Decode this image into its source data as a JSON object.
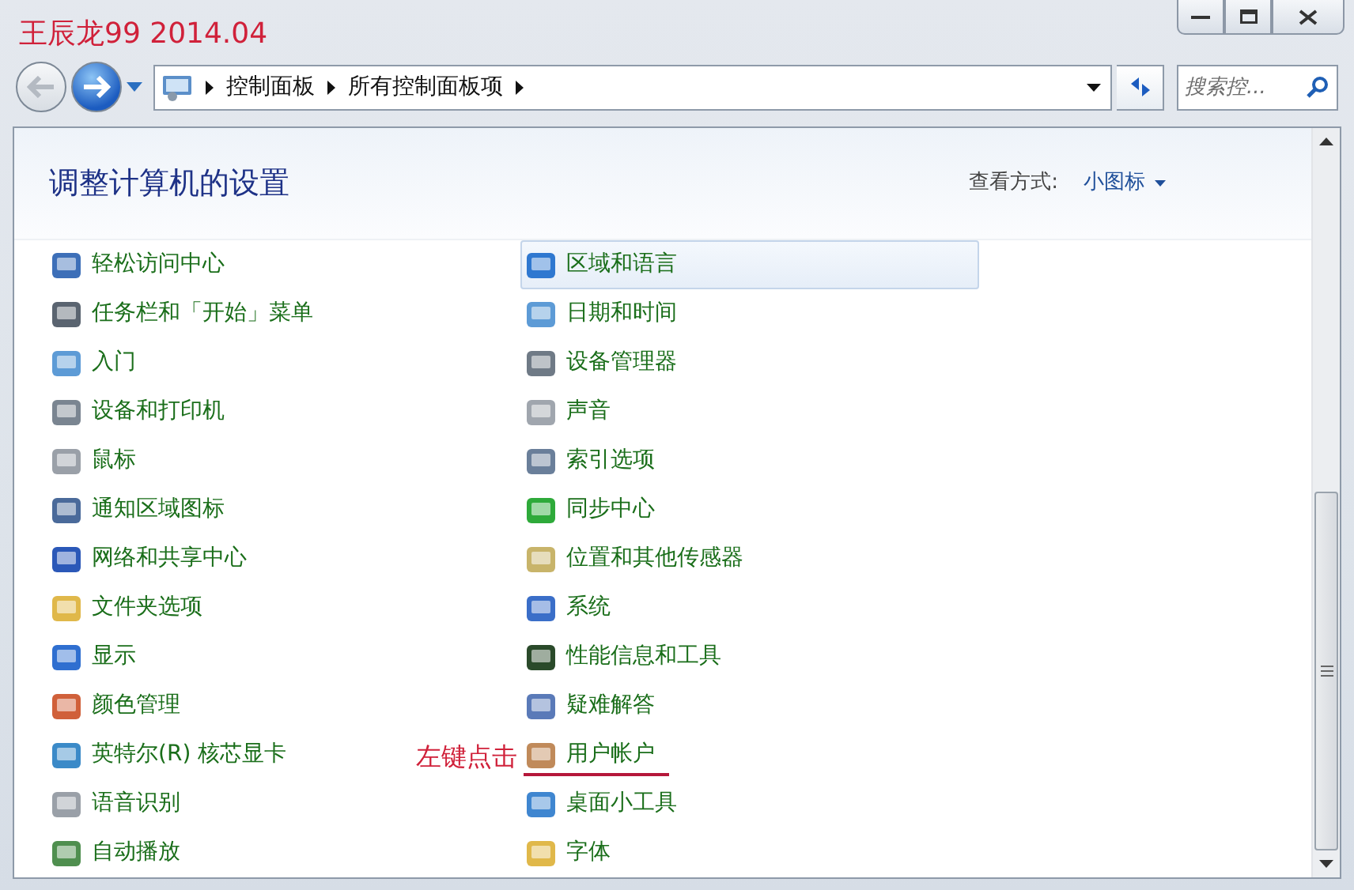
{
  "annotation_title": "王辰龙99 2014.04",
  "address_bar": {
    "back_disabled": true,
    "forward_disabled": false,
    "breadcrumbs": [
      "控制面板",
      "所有控制面板项"
    ]
  },
  "search": {
    "placeholder": "搜索控..."
  },
  "header": {
    "title": "调整计算机的设置",
    "view_label": "查看方式:",
    "view_value": "小图标"
  },
  "columns": [
    [
      {
        "label": "轻松访问中心",
        "highlighted": false
      },
      {
        "label": "任务栏和「开始」菜单",
        "highlighted": false
      },
      {
        "label": "入门",
        "highlighted": false
      },
      {
        "label": "设备和打印机",
        "highlighted": false
      },
      {
        "label": "鼠标",
        "highlighted": false
      },
      {
        "label": "通知区域图标",
        "highlighted": false
      },
      {
        "label": "网络和共享中心",
        "highlighted": false
      },
      {
        "label": "文件夹选项",
        "highlighted": false
      },
      {
        "label": "显示",
        "highlighted": false
      },
      {
        "label": "颜色管理",
        "highlighted": false
      },
      {
        "label": "英特尔(R) 核芯显卡",
        "highlighted": false
      },
      {
        "label": "语音识别",
        "highlighted": false
      },
      {
        "label": "自动播放",
        "highlighted": false
      }
    ],
    [
      {
        "label": "区域和语言",
        "highlighted": true
      },
      {
        "label": "日期和时间",
        "highlighted": false
      },
      {
        "label": "设备管理器",
        "highlighted": false
      },
      {
        "label": "声音",
        "highlighted": false
      },
      {
        "label": "索引选项",
        "highlighted": false
      },
      {
        "label": "同步中心",
        "highlighted": false
      },
      {
        "label": "位置和其他传感器",
        "highlighted": false
      },
      {
        "label": "系统",
        "highlighted": false
      },
      {
        "label": "性能信息和工具",
        "highlighted": false
      },
      {
        "label": "疑难解答",
        "highlighted": false
      },
      {
        "label": "用户帐户",
        "highlighted": false,
        "annotation": "左键点击"
      },
      {
        "label": "桌面小工具",
        "highlighted": false
      },
      {
        "label": "字体",
        "highlighted": false
      }
    ]
  ]
}
